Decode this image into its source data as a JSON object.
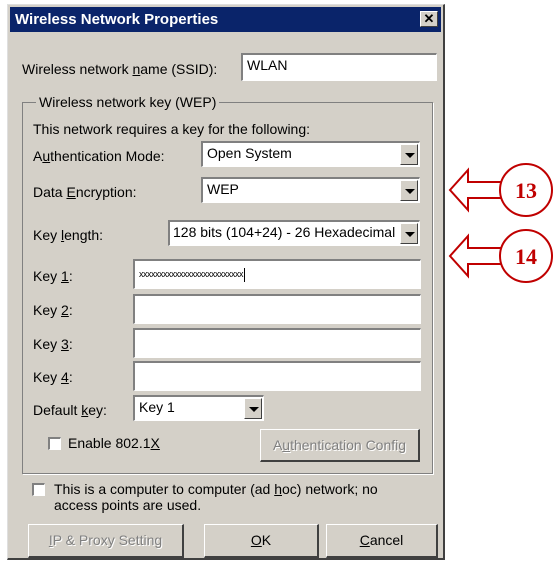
{
  "dialog": {
    "title": "Wireless Network Properties",
    "close_glyph": "✕"
  },
  "ssid": {
    "label_pre": "Wireless network ",
    "label_u": "n",
    "label_post": "ame (SSID):",
    "value": "WLAN"
  },
  "group": {
    "legend": "Wireless network key (WEP)",
    "note": "This network requires a key for the following:"
  },
  "auth": {
    "label_pre": "A",
    "label_u": "u",
    "label_post": "thentication Mode:",
    "value": "Open System"
  },
  "encryption": {
    "label_pre": "Data ",
    "label_u": "E",
    "label_post": "ncryption:",
    "value": "WEP"
  },
  "keylength": {
    "label_pre": "Key ",
    "label_u": "l",
    "label_post": "ength:",
    "value": "128 bits (104+24) - 26 Hexadecimal"
  },
  "keys": [
    {
      "label_pre": "Key ",
      "label_u": "1",
      "label_post": ":",
      "value": "xxxxxxxxxxxxxxxxxxxxxxxxxx"
    },
    {
      "label_pre": "Key ",
      "label_u": "2",
      "label_post": ":",
      "value": ""
    },
    {
      "label_pre": "Key ",
      "label_u": "3",
      "label_post": ":",
      "value": ""
    },
    {
      "label_pre": "Key ",
      "label_u": "4",
      "label_post": ":",
      "value": ""
    }
  ],
  "default_key": {
    "label_pre": "Default ",
    "label_u": "k",
    "label_post": "ey:",
    "value": "Key 1"
  },
  "enable8021x": {
    "label_pre": "Enable 802.1",
    "label_u": "X",
    "label_post": "",
    "checked": false
  },
  "auth_config": {
    "label_pre": "A",
    "label_u": "u",
    "label_post": "thentication Config",
    "enabled": false
  },
  "adhoc": {
    "line1_pre": "This is a computer to computer (ad ",
    "line1_u": "h",
    "line1_post": "oc) network; no",
    "line2": "access points are used.",
    "checked": false
  },
  "buttons": {
    "ip_proxy": {
      "label_pre": "",
      "label_u": "I",
      "label_post": "P & Proxy Setting",
      "enabled": false
    },
    "ok": {
      "label_pre": "",
      "label_u": "O",
      "label_post": "K"
    },
    "cancel": {
      "label_pre": "",
      "label_u": "C",
      "label_post": "ancel"
    }
  },
  "callouts": [
    {
      "number": "13",
      "points_to": "Data Encryption",
      "color": "#c00000"
    },
    {
      "number": "14",
      "points_to": "Key 1",
      "color": "#c00000"
    }
  ]
}
